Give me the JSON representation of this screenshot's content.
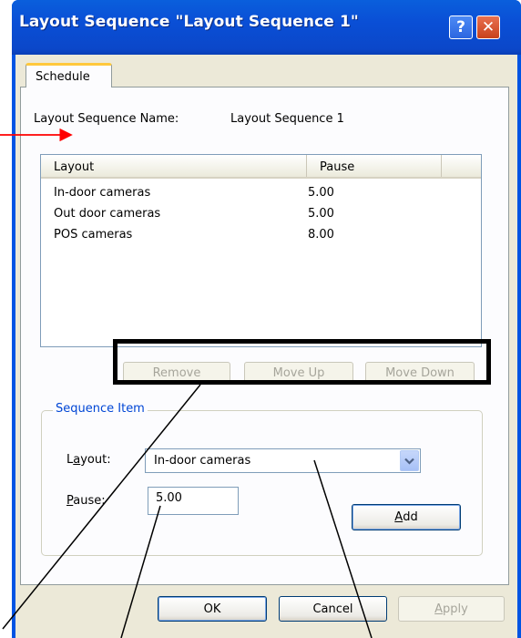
{
  "window": {
    "title": "Layout Sequence \"Layout Sequence 1\"",
    "help_glyph": "?",
    "close_glyph": "✕"
  },
  "tabs": [
    {
      "label": "Schedule"
    }
  ],
  "sequence_name": {
    "label": "Layout Sequence Name:",
    "value": "Layout Sequence 1"
  },
  "list": {
    "columns": [
      "Layout",
      "Pause"
    ],
    "rows": [
      {
        "layout": "In-door cameras",
        "pause": "5.00"
      },
      {
        "layout": "Out door cameras",
        "pause": "5.00"
      },
      {
        "layout": "POS cameras",
        "pause": "8.00"
      }
    ]
  },
  "list_buttons": {
    "remove": "Remove",
    "move_up": "Move Up",
    "move_down": "Move Down"
  },
  "sequence_item": {
    "group_title": "Sequence Item",
    "layout_label_prefix": "L",
    "layout_label_access": "a",
    "layout_label_rest": "yout:",
    "layout_value": "In-door cameras",
    "pause_label_access": "P",
    "pause_label_rest": "ause:",
    "pause_value": "5.00",
    "add_access": "A",
    "add_rest": "dd"
  },
  "footer": {
    "ok": "OK",
    "cancel": "Cancel",
    "apply_access": "A",
    "apply_rest": "pply"
  },
  "colors": {
    "titlebar": "#0054e3",
    "dialog_bg": "#ece9d8",
    "group_title": "#0046d5",
    "tab_highlight": "#ffc83c",
    "annotation_arrow": "#ff0000",
    "annotation_line": "#000000"
  },
  "icons": [
    "help-icon",
    "close-icon",
    "dropdown-arrow-icon"
  ]
}
